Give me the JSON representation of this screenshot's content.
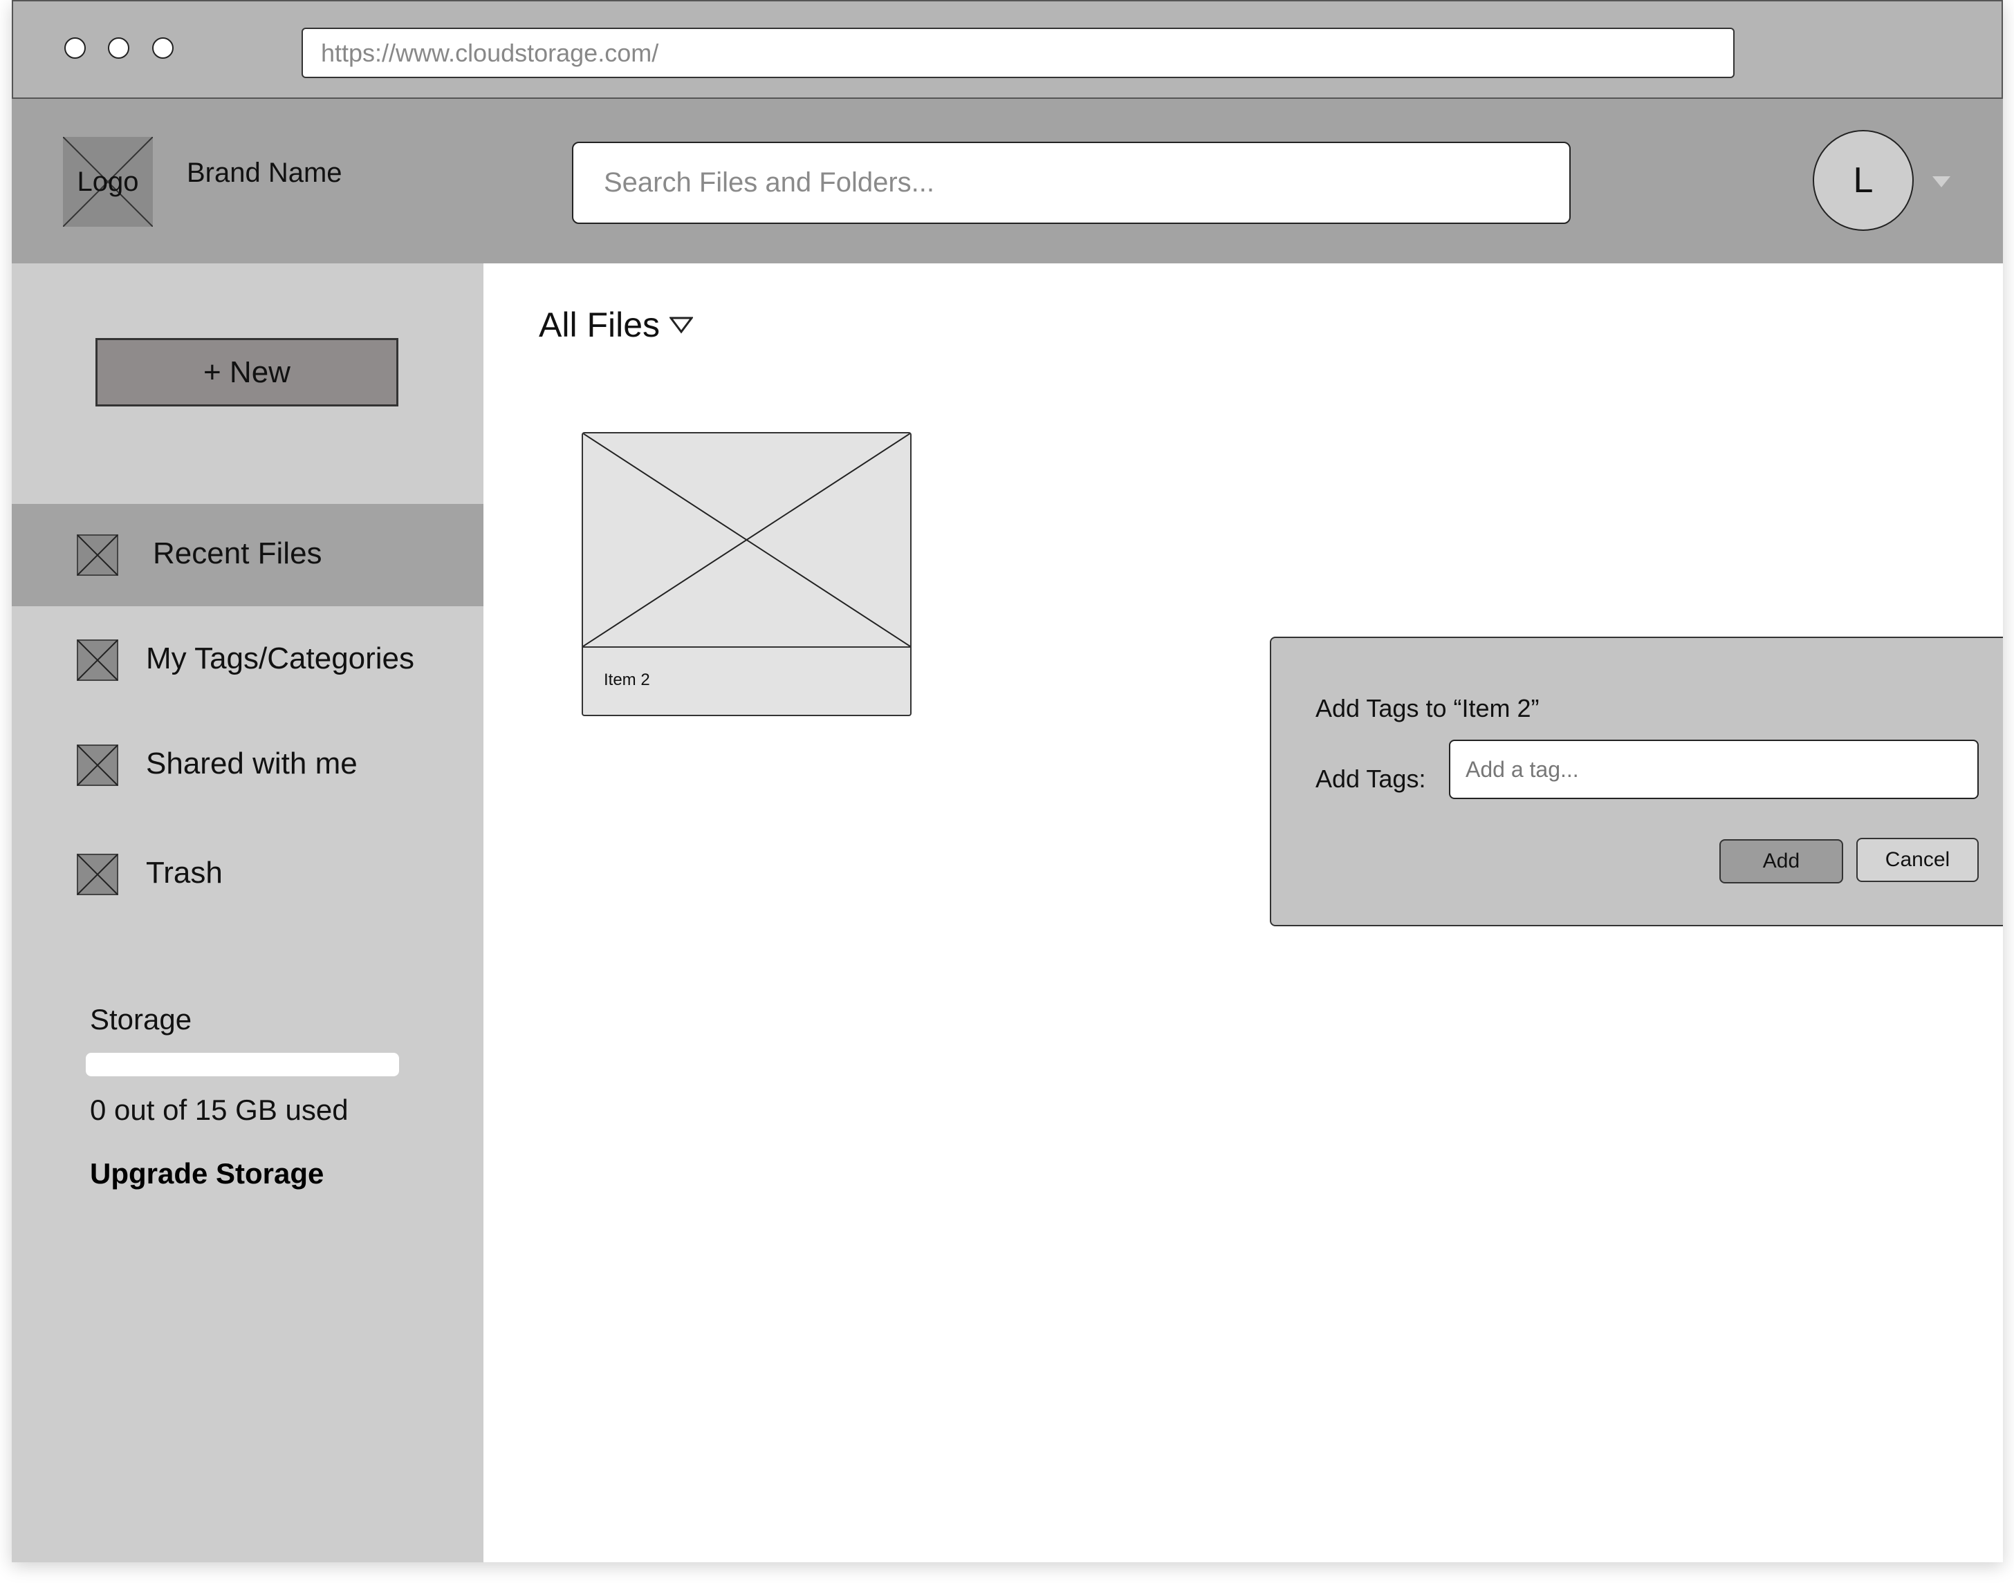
{
  "browser": {
    "url": "https://www.cloudstorage.com/"
  },
  "header": {
    "logo_text": "Logo",
    "brand_name": "Brand Name",
    "search_placeholder": "Search Files and Folders...",
    "avatar_initial": "L"
  },
  "sidebar": {
    "new_button": "+ New",
    "items": [
      {
        "label": "Recent Files",
        "active": true,
        "icon": "placeholder-icon"
      },
      {
        "label": "My Tags/Categories",
        "active": false,
        "icon": "placeholder-icon"
      },
      {
        "label": "Shared with me",
        "active": false,
        "icon": "placeholder-icon"
      },
      {
        "label": "Trash",
        "active": false,
        "icon": "placeholder-icon"
      }
    ],
    "storage": {
      "title": "Storage",
      "used_fraction": 0,
      "used_text": "0 out of 15 GB used",
      "upgrade_label": "Upgrade Storage"
    }
  },
  "main": {
    "section_title": "All Files",
    "files": [
      {
        "name": "Item 2"
      }
    ]
  },
  "dialog": {
    "title": "Add Tags to “Item 2”",
    "field_label": "Add Tags:",
    "input_placeholder": "Add a tag...",
    "add_label": "Add",
    "cancel_label": "Cancel"
  }
}
